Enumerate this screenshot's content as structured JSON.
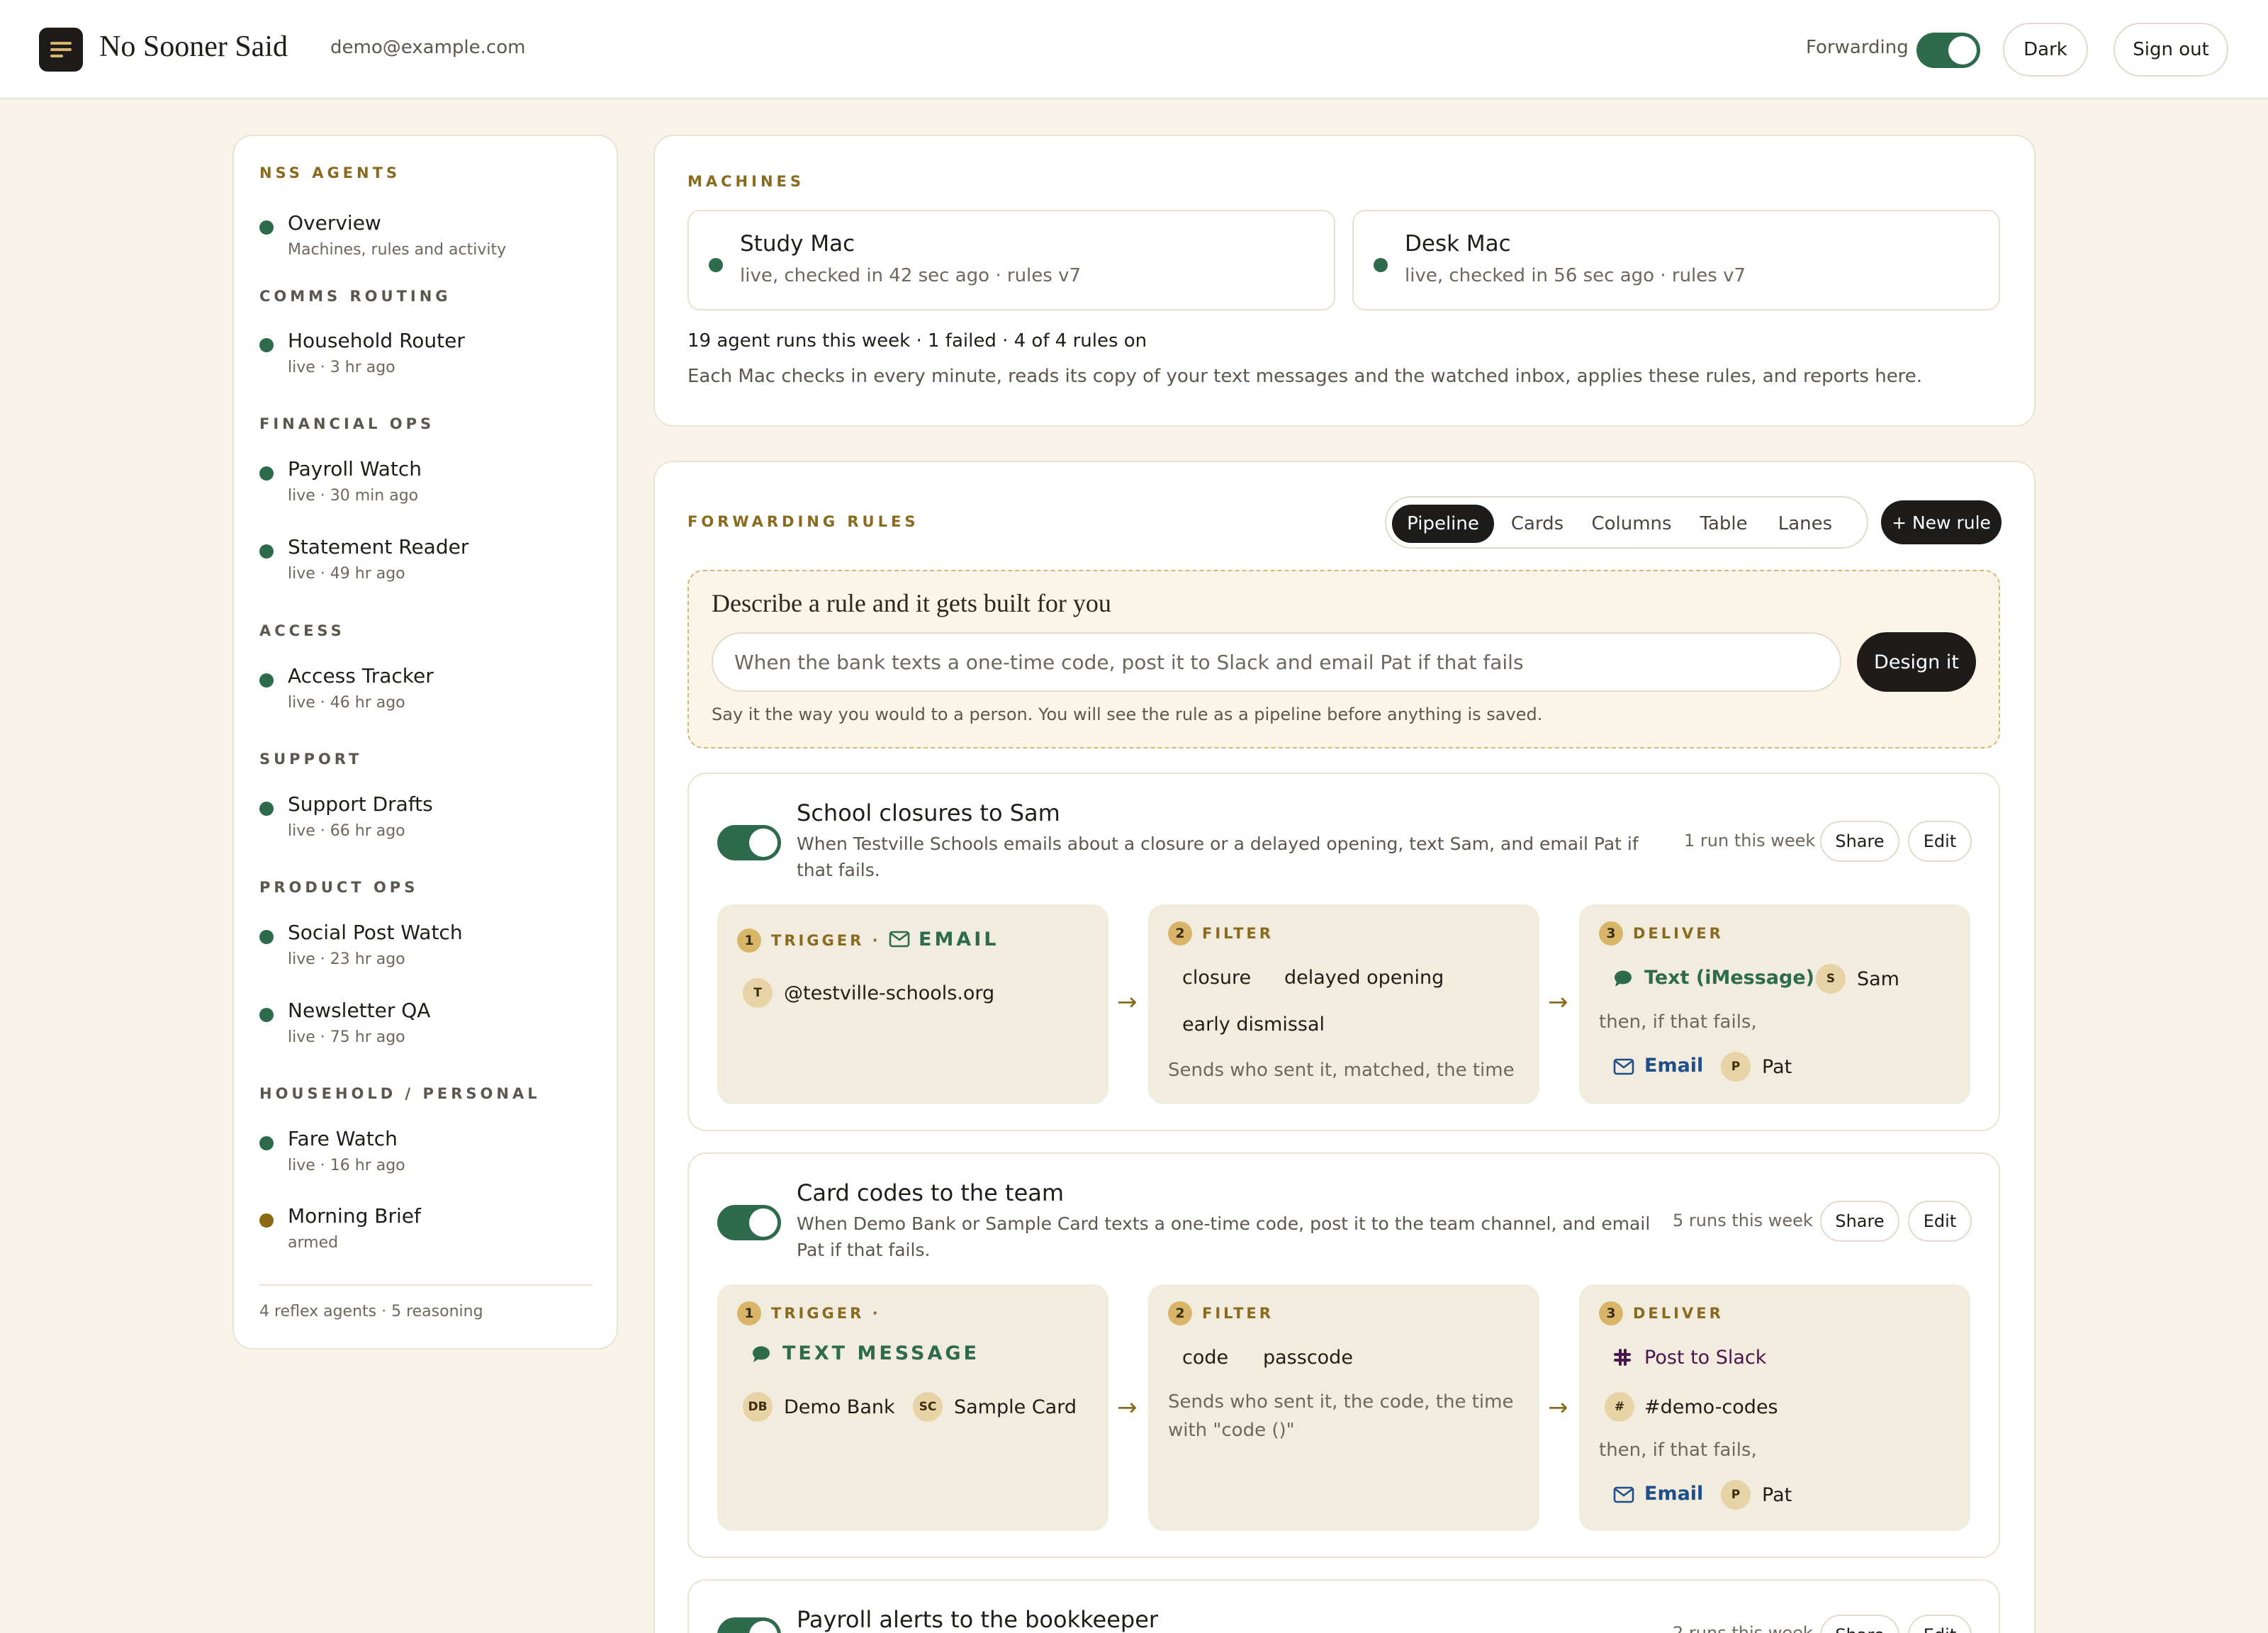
{
  "header": {
    "app_name": "No Sooner Said",
    "user_email": "demo@example.com",
    "forwarding_label": "Forwarding",
    "forwarding_on": true,
    "dark_label": "Dark",
    "signout_label": "Sign out"
  },
  "sidebar": {
    "title": "NSS AGENTS",
    "overview": {
      "name": "Overview",
      "sub": "Machines, rules and activity"
    },
    "sections": [
      {
        "heading": "COMMS ROUTING",
        "items": [
          {
            "name": "Household Router",
            "sub": "live · 3 hr ago"
          }
        ]
      },
      {
        "heading": "FINANCIAL OPS",
        "items": [
          {
            "name": "Payroll Watch",
            "sub": "live · 30 min ago"
          },
          {
            "name": "Statement Reader",
            "sub": "live · 49 hr ago"
          }
        ]
      },
      {
        "heading": "ACCESS",
        "items": [
          {
            "name": "Access Tracker",
            "sub": "live · 46 hr ago"
          }
        ]
      },
      {
        "heading": "SUPPORT",
        "items": [
          {
            "name": "Support Drafts",
            "sub": "live · 66 hr ago"
          }
        ]
      },
      {
        "heading": "PRODUCT OPS",
        "items": [
          {
            "name": "Social Post Watch",
            "sub": "live · 23 hr ago"
          },
          {
            "name": "Newsletter QA",
            "sub": "live · 75 hr ago"
          }
        ]
      },
      {
        "heading": "HOUSEHOLD / PERSONAL",
        "items": [
          {
            "name": "Fare Watch",
            "sub": "live · 16 hr ago"
          },
          {
            "name": "Morning Brief",
            "sub": "armed"
          }
        ]
      }
    ],
    "footer": "4 reflex agents · 5 reasoning"
  },
  "machines": {
    "label": "MACHINES",
    "items": [
      {
        "name": "Study Mac",
        "status": "live, checked in 42 sec ago · rules v7"
      },
      {
        "name": "Desk Mac",
        "status": "live, checked in 56 sec ago · rules v7"
      }
    ],
    "stats": "19 agent runs this week · 1 failed · 4 of 4 rules on",
    "description": "Each Mac checks in every minute, reads its copy of your text messages and the watched inbox, applies these rules, and reports here."
  },
  "rules": {
    "label": "FORWARDING RULES",
    "views": [
      "Pipeline",
      "Cards",
      "Columns",
      "Table",
      "Lanes"
    ],
    "active_view": "Pipeline",
    "new_rule_label": "+ New rule",
    "describe": {
      "title": "Describe a rule and it gets built for you",
      "placeholder": "When the bank texts a one-time code, post it to Slack and email Pat if that fails",
      "button": "Design it",
      "hint": "Say it the way you would to a person. You will see the rule as a pipeline before anything is saved."
    },
    "share_label": "Share",
    "edit_label": "Edit",
    "items": [
      {
        "title": "School closures to Sam",
        "description": "When Testville Schools emails about a closure or a delayed opening, text Sam, and email Pat if that fails.",
        "runs": "1 run this week",
        "enabled": true,
        "trigger": {
          "num": "1",
          "label": "TRIGGER ·",
          "channel": "EMAIL",
          "sources": [
            {
              "initials": "T",
              "name": "@testville-schools.org"
            }
          ]
        },
        "filter": {
          "num": "2",
          "label": "FILTER",
          "keywords": [
            "closure",
            "delayed opening",
            "early dismissal"
          ],
          "note": "Sends who sent it, matched, the time"
        },
        "deliver": {
          "num": "3",
          "label": "DELIVER",
          "primary": "Text (iMessage)",
          "primary_target": {
            "initials": "S",
            "name": "Sam"
          },
          "fallback_text": "then, if that fails,",
          "fallback": "Email",
          "fallback_target": {
            "initials": "P",
            "name": "Pat"
          }
        }
      },
      {
        "title": "Card codes to the team",
        "description": "When Demo Bank or Sample Card texts a one-time code, post it to the team channel, and email Pat if that fails.",
        "runs": "5 runs this week",
        "enabled": true,
        "trigger": {
          "num": "1",
          "label": "TRIGGER ·",
          "channel": "TEXT MESSAGE",
          "sources": [
            {
              "initials": "DB",
              "name": "Demo Bank"
            },
            {
              "initials": "SC",
              "name": "Sample Card"
            }
          ]
        },
        "filter": {
          "num": "2",
          "label": "FILTER",
          "keywords": [
            "code",
            "passcode"
          ],
          "note": "Sends who sent it, the code, the time with \"code ()\""
        },
        "deliver": {
          "num": "3",
          "label": "DELIVER",
          "primary": "Post to Slack",
          "primary_target": {
            "initials": "#",
            "name": "#demo-codes"
          },
          "fallback_text": "then, if that fails,",
          "fallback": "Email",
          "fallback_target": {
            "initials": "P",
            "name": "Pat"
          }
        }
      },
      {
        "title": "Payroll alerts to the bookkeeper",
        "runs": "2 runs this week",
        "enabled": true
      }
    ]
  },
  "colors": {
    "background": "#f8f4ea",
    "accent_green": "#2e6b4c",
    "accent_gold": "#8a6a1e",
    "dark": "#1d1c1a",
    "armed_dot": "#8b6914"
  }
}
